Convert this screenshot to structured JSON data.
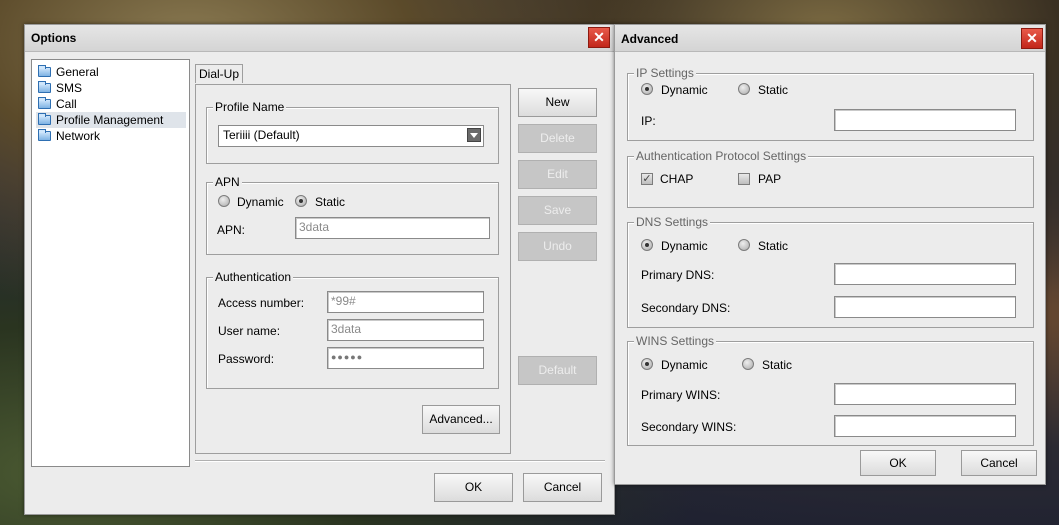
{
  "options": {
    "title": "Options",
    "tree": [
      "General",
      "SMS",
      "Call",
      "Profile Management",
      "Network"
    ],
    "tab": "Dial-Up",
    "profile": {
      "legend": "Profile Name",
      "value": "Teriiii (Default)"
    },
    "apn": {
      "legend": "APN",
      "dynamic": "Dynamic",
      "static": "Static",
      "label": "APN:",
      "value": "3data"
    },
    "auth": {
      "legend": "Authentication",
      "access_label": "Access number:",
      "access_value": "*99#",
      "user_label": "User name:",
      "user_value": "3data",
      "pass_label": "Password:",
      "pass_value": "●●●●●"
    },
    "buttons": {
      "new": "New",
      "delete": "Delete",
      "edit": "Edit",
      "save": "Save",
      "undo": "Undo",
      "default": "Default",
      "advanced": "Advanced...",
      "ok": "OK",
      "cancel": "Cancel"
    }
  },
  "advanced": {
    "title": "Advanced",
    "ip": {
      "legend": "IP Settings",
      "dynamic": "Dynamic",
      "static": "Static",
      "label": "IP:"
    },
    "auth_proto": {
      "legend": "Authentication Protocol Settings",
      "chap": "CHAP",
      "pap": "PAP"
    },
    "dns": {
      "legend": "DNS Settings",
      "dynamic": "Dynamic",
      "static": "Static",
      "primary": "Primary DNS:",
      "secondary": "Secondary DNS:"
    },
    "wins": {
      "legend": "WINS Settings",
      "dynamic": "Dynamic",
      "static": "Static",
      "primary": "Primary WINS:",
      "secondary": "Secondary WINS:"
    },
    "buttons": {
      "ok": "OK",
      "cancel": "Cancel"
    }
  }
}
